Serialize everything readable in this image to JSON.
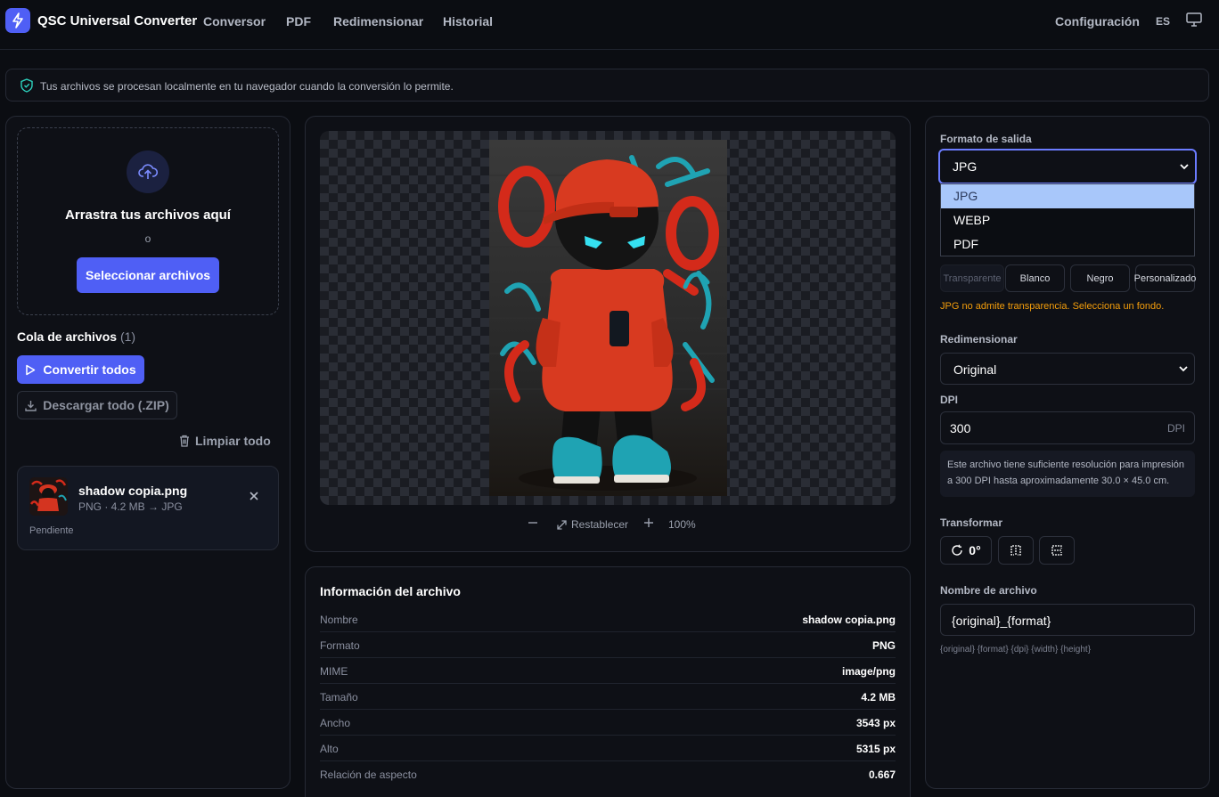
{
  "app": {
    "title": "QSC Universal Converter",
    "accent_color": "#4f5ff5"
  },
  "nav": {
    "items": [
      "Conversor",
      "PDF",
      "Redimensionar",
      "Historial"
    ],
    "settings_label": "Configuración",
    "language": "ES",
    "monitor_icon": "monitor-icon"
  },
  "banner": {
    "icon": "shield-check-icon",
    "text": "Tus archivos se procesan localmente en tu navegador cuando la conversión lo permite."
  },
  "upload": {
    "icon": "upload-cloud-icon",
    "title": "Arrastra tus archivos aquí",
    "or": "o",
    "select_button": "Seleccionar archivos"
  },
  "queue": {
    "title": "Cola de archivos",
    "count": "(1)",
    "convert_all": "Convertir todos",
    "download_all": "Descargar todo (.ZIP)",
    "clear_all": "Limpiar todo",
    "files": [
      {
        "name": "shadow copia.png",
        "meta": "PNG · 4.2 MB → JPG",
        "status": "Pendiente"
      }
    ]
  },
  "preview": {
    "reset_label": "Restablecer",
    "zoom": "100%"
  },
  "info": {
    "title": "Información del archivo",
    "rows": [
      {
        "key": "Nombre",
        "value": "shadow copia.png"
      },
      {
        "key": "Formato",
        "value": "PNG"
      },
      {
        "key": "MIME",
        "value": "image/png"
      },
      {
        "key": "Tamaño",
        "value": "4.2 MB"
      },
      {
        "key": "Ancho",
        "value": "3543 px"
      },
      {
        "key": "Alto",
        "value": "5315 px"
      },
      {
        "key": "Relación de aspecto",
        "value": "0.667"
      }
    ]
  },
  "settings": {
    "output_format_label": "Formato de salida",
    "output_format_value": "JPG",
    "format_options": [
      "JPG",
      "WEBP",
      "PDF"
    ],
    "background_options": [
      "Transparente",
      "Blanco",
      "Negro",
      "Personalizado"
    ],
    "transparency_warning": "JPG no admite transparencia. Selecciona un fondo.",
    "resize_label": "Redimensionar",
    "resize_value": "Original",
    "dpi_label": "DPI",
    "dpi_value": "300",
    "dpi_unit": "DPI",
    "dpi_note": "Este archivo tiene suficiente resolución para impresión a 300 DPI hasta aproximadamente 30.0 × 45.0 cm.",
    "transform_label": "Transformar",
    "rotation": "0°",
    "filename_label": "Nombre de archivo",
    "filename_value": "{original}_{format}",
    "filename_tokens": "{original} {format} {dpi} {width} {height}"
  }
}
